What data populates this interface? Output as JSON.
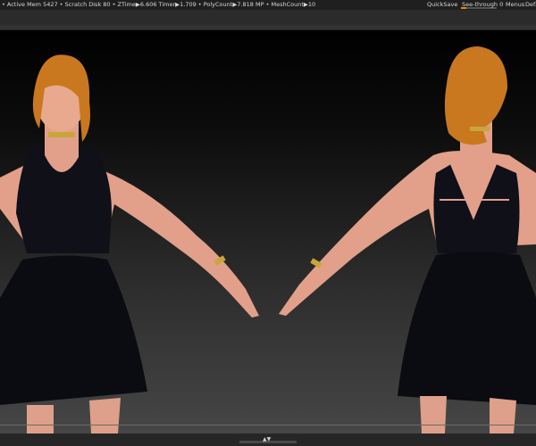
{
  "status_bar": {
    "stats": "• Active Mem 5427 • Scratch Disk 80 • ZTime▶6.606 Timer▶1.709 • PolyCount▶7.818 MP • MeshCount▶10",
    "quicksave": "QuickSave",
    "see_through": "See-through  0",
    "see_through_value": 0,
    "menus": "Menus",
    "default": "Defa"
  },
  "colors": {
    "accent": "#f08a00",
    "skin": "#e8a98f",
    "hair": "#c9781f",
    "cloth": "#0e0e16",
    "gold": "#c9a63a"
  },
  "bottom_bar": {
    "handle_icon": "up-down-arrows-icon",
    "arrows": "▲▼"
  }
}
